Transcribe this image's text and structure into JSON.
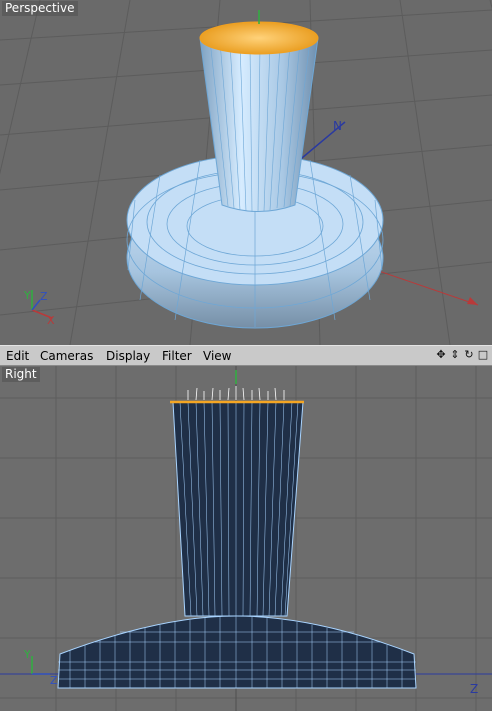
{
  "viewports": {
    "top": {
      "label": "Perspective"
    },
    "bottom": {
      "label": "Right"
    }
  },
  "menubar": {
    "items": [
      "Edit",
      "Cameras",
      "Display",
      "Filter",
      "View"
    ],
    "icons": [
      "move-view-icon",
      "zoom-view-icon",
      "rotate-view-icon",
      "maximize-view-icon"
    ]
  },
  "axes": {
    "persp": {
      "x": "X",
      "y": "Y",
      "z": "Z"
    },
    "right": {
      "y": "Y",
      "z": "Z",
      "world_z": "Z"
    }
  },
  "colors": {
    "mesh": "#bfe0ff",
    "wire": "#6ea7d6",
    "selection": "#f5a623",
    "grid": "#5a5a5a",
    "x_axis": "#c03030",
    "y_axis": "#30b040",
    "z_axis": "#3050c0"
  }
}
